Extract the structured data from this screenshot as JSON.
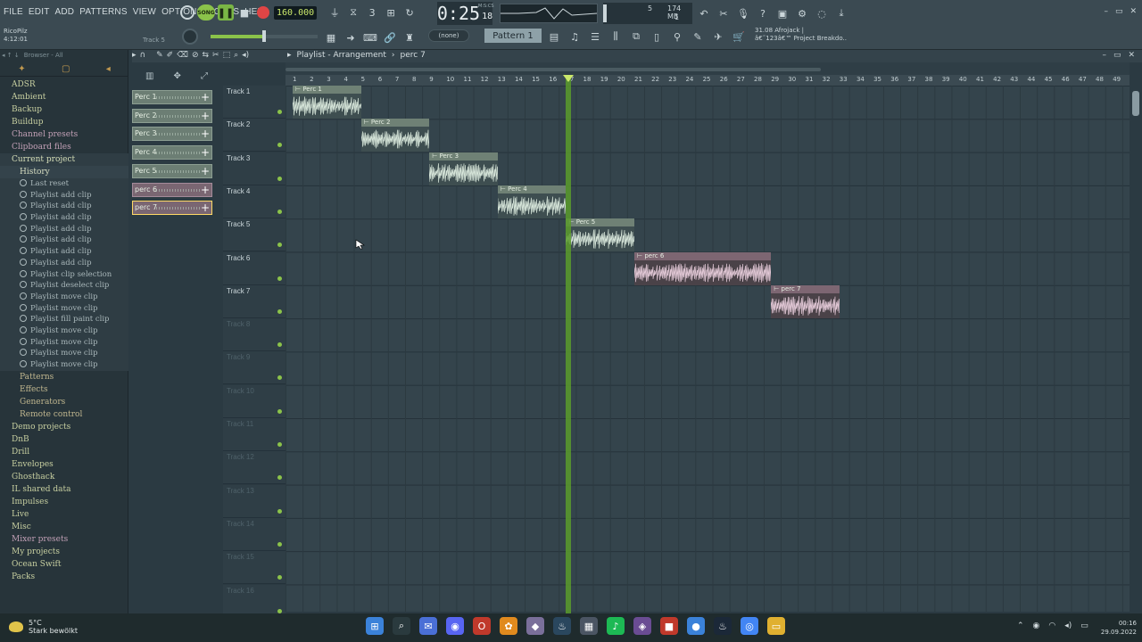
{
  "menu": [
    "FILE",
    "EDIT",
    "ADD",
    "PATTERNS",
    "VIEW",
    "OPTIONS",
    "TOOLS",
    "HELP"
  ],
  "transport": {
    "song_label": "SONG",
    "tempo": "160.000",
    "time_main": "0:25",
    "time_sub": "18",
    "time_unit": "M:S:CS"
  },
  "cpu": {
    "cpu_value": "5",
    "ram": "174 MB",
    "poly": "1"
  },
  "user": {
    "name": "RicoPilz",
    "time": "4:12:01",
    "hint": "Track 5"
  },
  "pattern": {
    "none_label": "(none)",
    "pattern_label": "Pattern 1"
  },
  "news": {
    "line1": "31.08  Afrojack |",
    "line2": "â€˜123â€™ Project Breakdo.."
  },
  "browser": {
    "header": "Browser - All",
    "items": [
      {
        "label": "ADSR",
        "style": "normal"
      },
      {
        "label": "Ambient",
        "style": "normal"
      },
      {
        "label": "Backup",
        "style": "normal"
      },
      {
        "label": "Buildup",
        "style": "normal"
      },
      {
        "label": "Channel presets",
        "style": "pink"
      },
      {
        "label": "Clipboard files",
        "style": "pink"
      },
      {
        "label": "Current project",
        "style": "current"
      }
    ],
    "history_label": "History",
    "history": [
      "Last reset",
      "Playlist add clip",
      "Playlist add clip",
      "Playlist add clip",
      "Playlist add clip",
      "Playlist add clip",
      "Playlist add clip",
      "Playlist add clip",
      "Playlist clip selection",
      "Playlist deselect clip",
      "Playlist move clip",
      "Playlist move clip",
      "Playlist fill paint clip",
      "Playlist move clip",
      "Playlist move clip",
      "Playlist move clip",
      "Playlist move clip"
    ],
    "project_sub": [
      "Patterns",
      "Effects",
      "Generators",
      "Remote control"
    ],
    "items2": [
      {
        "label": "Demo projects",
        "style": "normal"
      },
      {
        "label": "DnB",
        "style": "normal"
      },
      {
        "label": "Drill",
        "style": "normal"
      },
      {
        "label": "Envelopes",
        "style": "normal"
      },
      {
        "label": "Ghosthack",
        "style": "normal"
      },
      {
        "label": "IL shared data",
        "style": "normal"
      },
      {
        "label": "Impulses",
        "style": "normal"
      },
      {
        "label": "Live",
        "style": "normal"
      },
      {
        "label": "Misc",
        "style": "normal"
      },
      {
        "label": "Mixer presets",
        "style": "pink"
      },
      {
        "label": "My projects",
        "style": "normal"
      },
      {
        "label": "Ocean Swift",
        "style": "normal"
      },
      {
        "label": "Packs",
        "style": "normal"
      }
    ]
  },
  "picker": [
    {
      "label": "Perc 1",
      "pink": false,
      "selected": false
    },
    {
      "label": "Perc 2",
      "pink": false,
      "selected": false
    },
    {
      "label": "Perc 3",
      "pink": false,
      "selected": false
    },
    {
      "label": "Perc 4",
      "pink": false,
      "selected": false
    },
    {
      "label": "Perc 5",
      "pink": false,
      "selected": false
    },
    {
      "label": "perc 6",
      "pink": true,
      "selected": false
    },
    {
      "label": "perc 7",
      "pink": true,
      "selected": true
    }
  ],
  "playlist": {
    "title": "Playlist - Arrangement",
    "pattern": "perc 7",
    "tracks": [
      "Track 1",
      "Track 2",
      "Track 3",
      "Track 4",
      "Track 5",
      "Track 6",
      "Track 7",
      "Track 8",
      "Track 9",
      "Track 10",
      "Track 11",
      "Track 12",
      "Track 13",
      "Track 14",
      "Track 15",
      "Track 16"
    ],
    "active_tracks": 7,
    "bars": [
      1,
      2,
      3,
      4,
      5,
      6,
      7,
      8,
      9,
      10,
      11,
      12,
      13,
      14,
      15,
      16,
      17,
      18,
      19,
      20,
      21,
      22,
      23,
      24,
      25,
      26,
      27,
      28,
      29,
      30,
      31,
      32,
      33,
      34,
      35,
      36,
      37,
      38,
      39,
      40,
      41,
      42,
      43,
      44,
      45,
      46,
      47,
      48,
      49
    ],
    "clips": [
      {
        "label": "Perc 1",
        "track": 1,
        "start": 1,
        "end": 5,
        "pink": false
      },
      {
        "label": "Perc 2",
        "track": 2,
        "start": 5,
        "end": 9,
        "pink": false
      },
      {
        "label": "Perc 3",
        "track": 3,
        "start": 9,
        "end": 13,
        "pink": false
      },
      {
        "label": "Perc 4",
        "track": 4,
        "start": 13,
        "end": 17,
        "pink": false
      },
      {
        "label": "Perc 5",
        "track": 5,
        "start": 17,
        "end": 21,
        "pink": false
      },
      {
        "label": "perc 6",
        "track": 6,
        "start": 21,
        "end": 29,
        "pink": true
      },
      {
        "label": "perc 7",
        "track": 7,
        "start": 29,
        "end": 33,
        "pink": true
      }
    ],
    "playhead_bar": 17.1
  },
  "taskbar": {
    "weather_temp": "5°C",
    "weather_desc": "Stark bewölkt",
    "time": "00:16",
    "date": "29.09.2022",
    "apps": [
      "windows-start",
      "search",
      "teams-chat",
      "discord",
      "opera",
      "fl-studio",
      "game-app",
      "steam",
      "file-manager",
      "spotify",
      "vpn-app",
      "red-app",
      "blue-app",
      "steam-alt",
      "chrome",
      "explorer"
    ]
  },
  "colors": {
    "accent_green": "#8bc34a",
    "clip_green": "#6f8175",
    "clip_pink": "#7d6672",
    "playhead": "#5b9b2c"
  }
}
